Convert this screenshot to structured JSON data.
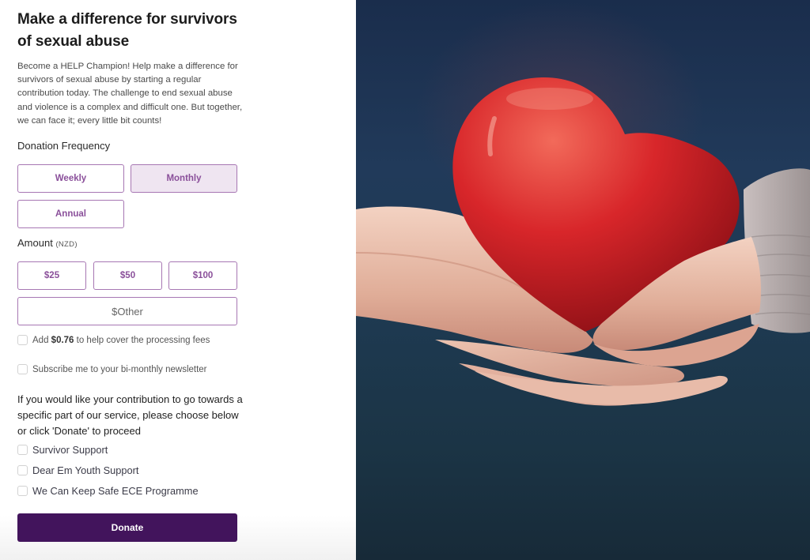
{
  "header": {
    "title": "Make a difference for survivors of sexual abuse",
    "intro": "Become a HELP Champion! Help make a difference for survivors of sexual abuse by starting a regular contribution today. The challenge to end sexual abuse and violence is a complex and difficult one. But together, we can face it; every little bit counts!"
  },
  "frequency": {
    "label": "Donation Frequency",
    "options": [
      {
        "label": "Weekly",
        "selected": false
      },
      {
        "label": "Monthly",
        "selected": true
      },
      {
        "label": "Annual",
        "selected": false
      }
    ]
  },
  "amount": {
    "label": "Amount",
    "currency": "(NZD)",
    "options": [
      "$25",
      "$50",
      "$100"
    ],
    "other_label": "$Other"
  },
  "options": {
    "fees": {
      "prefix": "Add ",
      "amount": "$0.76",
      "suffix": " to help cover the processing fees",
      "checked": false
    },
    "newsletter": {
      "label": "Subscribe me to your bi-monthly newsletter",
      "checked": false
    }
  },
  "designation": {
    "question": "If you would like your contribution to go towards a specific part of our service, please choose below or click 'Donate' to proceed",
    "items": [
      {
        "label": "Survivor Support",
        "checked": false
      },
      {
        "label": "Dear Em Youth Support",
        "checked": false
      },
      {
        "label": "We Can Keep Safe ECE Programme",
        "checked": false
      }
    ]
  },
  "donate_label": "Donate",
  "image": {
    "description": "Two cupped hands holding a red heart against a dark blue background"
  },
  "colors": {
    "primary": "#42145c",
    "accent": "#8a4f9a",
    "selected_bg": "#efe5f1",
    "border": "#a777b3"
  }
}
